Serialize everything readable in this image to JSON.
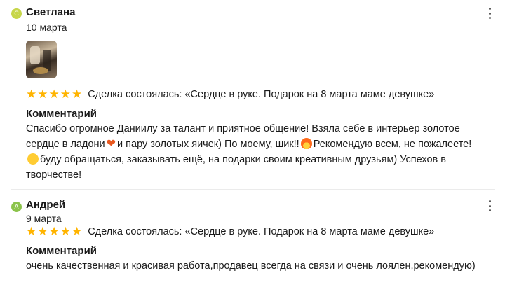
{
  "reviews": [
    {
      "avatar_letter": "С",
      "avatar_color": "#c7d64a",
      "name": "Светлана",
      "date": "10 марта",
      "rating": 5,
      "deal_text": "Сделка состоялась: «Сердце в руке. Подарок на 8 марта маме девушке»",
      "comment_title": "Комментарий",
      "comment_lines": [
        "Спасибо огромное Даниилу за талант и приятное общение! Взяла себе в интерьер золотое",
        "сердце в ладони",
        "и пару золотых яичек) По моему, шик!!",
        "Рекомендую всем, не пожалеете!",
        "буду обращаться, заказывать ещё, на подарки своим креативным друзьям) Успехов в",
        "творчестве!"
      ]
    },
    {
      "avatar_letter": "А",
      "avatar_color": "#8bc34a",
      "name": "Андрей",
      "date": "9 марта",
      "rating": 5,
      "deal_text": "Сделка состоялась: «Сердце в руке. Подарок на 8 марта маме девушке»",
      "comment_title": "Комментарий",
      "comment_text": "очень качественная и красивая работа,продавец всегда на связи и очень лоялен,рекомендую)"
    }
  ],
  "icons": {
    "star": "star-icon",
    "more": "more-vertical-icon",
    "heart": "heart-emoji-icon",
    "flame": "fire-emoji-icon",
    "smile": "smiling-face-emoji-icon"
  }
}
